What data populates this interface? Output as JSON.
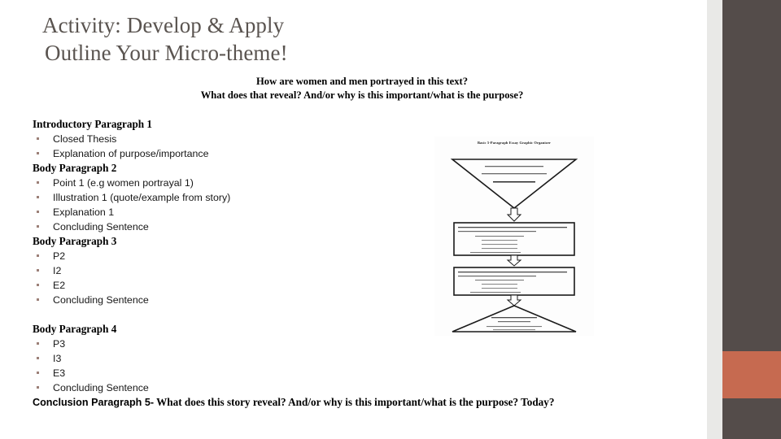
{
  "slide": {
    "background_color": "#ffffff",
    "accent_bar_color": "#544c4a",
    "accent_highlight_color": "#c66a50",
    "gap_color": "#e9e9e7",
    "title_color": "#5a5450",
    "bullet_color": "#9c8078"
  },
  "title": {
    "line1": "Activity: Develop & Apply",
    "line2": "Outline Your Micro-theme!"
  },
  "subtitle": {
    "line1": "How are women and men portrayed in this text?",
    "line2": "What does that reveal? And/or why is this important/what is the purpose?"
  },
  "outline": {
    "blocks": [
      {
        "heading": "Introductory Paragraph 1",
        "items": [
          "Closed Thesis",
          "Explanation of purpose/importance"
        ]
      },
      {
        "heading": "Body Paragraph 2",
        "items": [
          "Point 1 (e.g women portrayal 1)",
          "Illustration 1 (quote/example from story)",
          "Explanation 1",
          "Concluding Sentence"
        ]
      },
      {
        "heading": "Body Paragraph 3",
        "items": [
          "P2",
          "I2",
          "E2",
          "Concluding Sentence"
        ]
      },
      {
        "heading": "Body Paragraph 4",
        "items": [
          "P3",
          "I3",
          "E3",
          "Concluding Sentence"
        ]
      }
    ]
  },
  "conclusion": {
    "lead": "Conclusion Paragraph 5-",
    "rest": " What does this story reveal? And/or why is this important/what is the purpose? Today?"
  },
  "organizer": {
    "title": "Basic 5-Paragraph Essay Graphic Organizer",
    "intro_lines": [
      "1. Paragraph 1: Attention Getter",
      "TOPIC : Background Info (5 W's)",
      "THESIS STATEMENT"
    ],
    "body_boxes": [
      "II. Paragraph II:  Introduce and support your FIRST supporting idea with three pieces of evidence",
      "III. Paragraph III:  Introduce and support your SECOND supporting idea with three pieces of evidence",
      "IV. Paragraph IV:  Introduce and support your THIRD supporting idea with three pieces of evidence"
    ],
    "conclusion_lines": [
      "V. Paragraph V - Restate Thesis Statement",
      "RECAP three main supporting points (1, 2, 3)",
      "CLOSING / Clincher Statement"
    ]
  }
}
